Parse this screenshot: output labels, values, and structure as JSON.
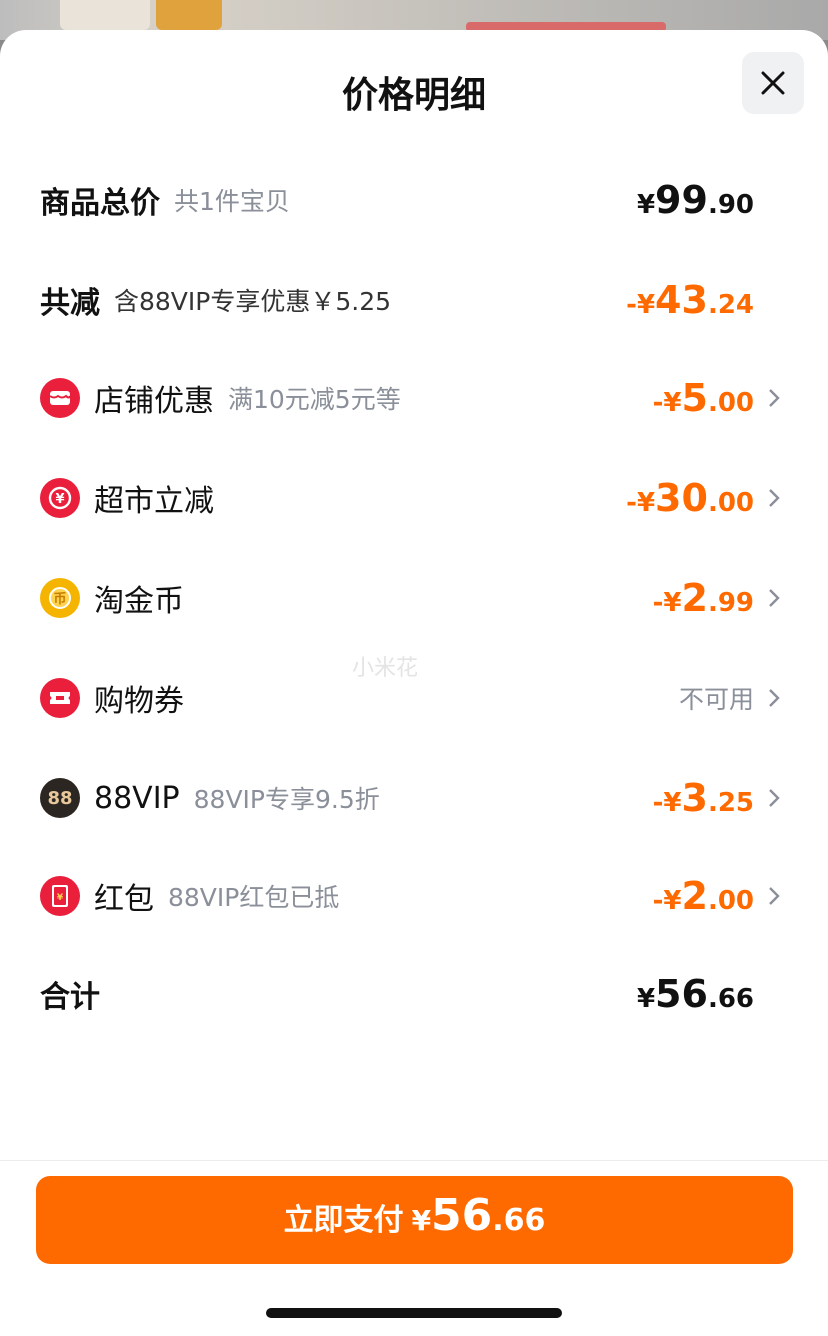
{
  "sheet": {
    "title": "价格明细",
    "close_label": "close"
  },
  "rows": {
    "total": {
      "label": "商品总价",
      "sub": "共1件宝贝",
      "currency": "¥",
      "int": "99",
      "dec": ".90"
    },
    "reduce": {
      "label": "共减",
      "sub": "含88VIP专享优惠￥5.25",
      "currency": "-¥",
      "int": "43",
      "dec": ".24"
    },
    "store": {
      "label": "店铺优惠",
      "sub": "满10元减5元等",
      "currency": "-¥",
      "int": "5",
      "dec": ".00",
      "icon": "store-coupon-icon"
    },
    "market": {
      "label": "超市立减",
      "currency": "-¥",
      "int": "30",
      "dec": ".00",
      "icon": "yuan-circle-icon"
    },
    "coin": {
      "label": "淘金币",
      "currency": "-¥",
      "int": "2",
      "dec": ".99",
      "icon": "gold-coin-icon"
    },
    "voucher": {
      "label": "购物券",
      "status": "不可用",
      "icon": "ticket-icon"
    },
    "vip": {
      "label": "88VIP",
      "sub": "88VIP专享9.5折",
      "currency": "-¥",
      "int": "3",
      "dec": ".25",
      "icon": "88vip-badge-icon",
      "badge": "88"
    },
    "redpack": {
      "label": "红包",
      "sub": "88VIP红包已抵",
      "currency": "-¥",
      "int": "2",
      "dec": ".00",
      "icon": "red-packet-icon"
    },
    "sum": {
      "label": "合计",
      "currency": "¥",
      "int": "56",
      "dec": ".66"
    }
  },
  "watermark": "小米花",
  "pay": {
    "label": "立即支付",
    "currency": "¥",
    "int": "56",
    "dec": ".66"
  },
  "colors": {
    "accent": "#ff6a00",
    "icon_red": "#ea1f3b",
    "icon_gold": "#f5b400",
    "vip_dark": "#2b2622"
  }
}
